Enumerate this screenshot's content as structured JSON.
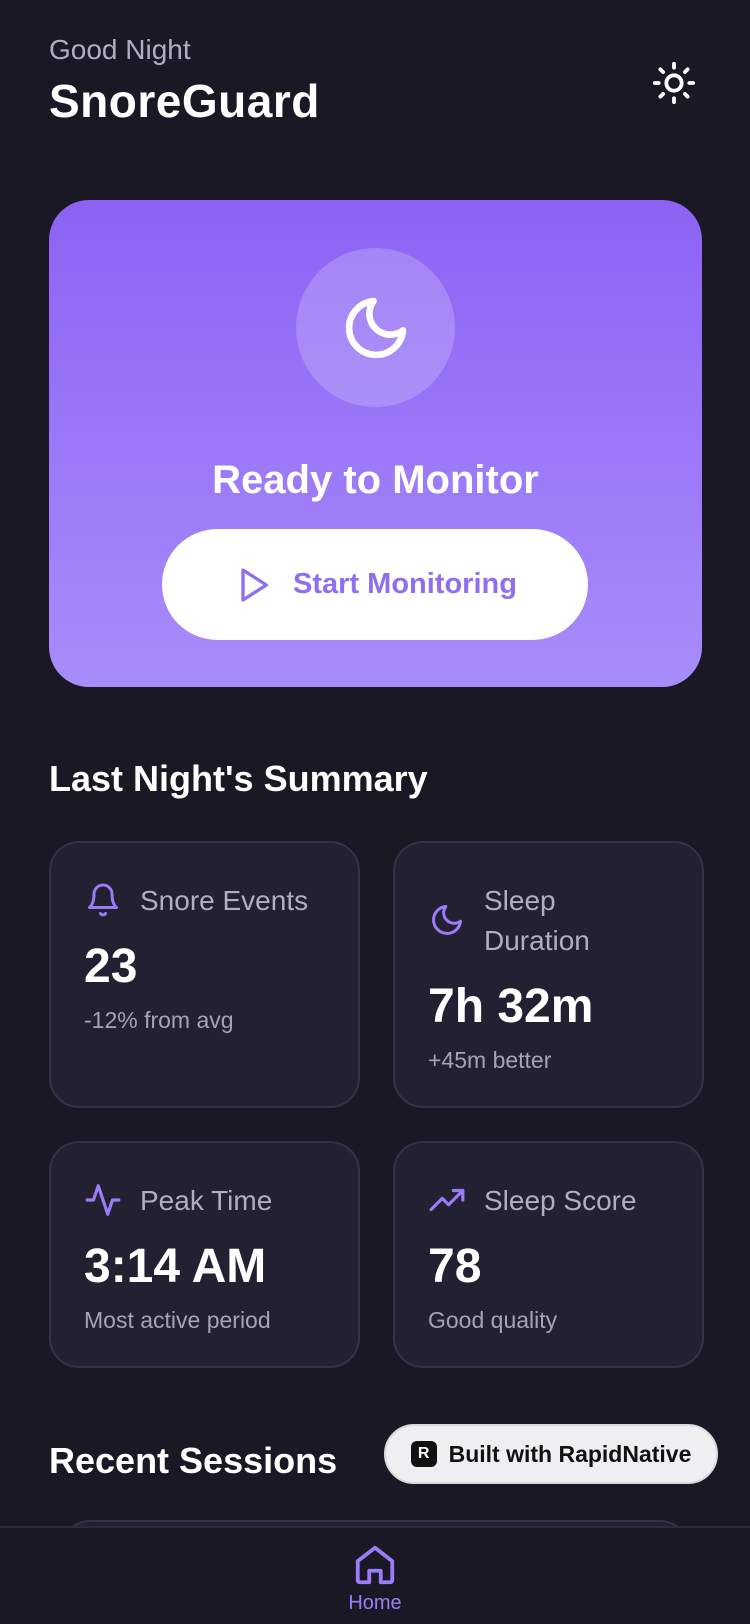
{
  "header": {
    "greeting": "Good Night",
    "title": "SnoreGuard",
    "theme_icon": "sun-icon"
  },
  "hero": {
    "icon": "moon-icon",
    "status": "Ready to Monitor",
    "button_label": "Start Monitoring",
    "button_icon": "play-icon"
  },
  "summary": {
    "title": "Last Night's Summary",
    "cards": [
      {
        "icon": "bell-icon",
        "label": "Snore Events",
        "value": "23",
        "sub": "-12% from avg"
      },
      {
        "icon": "moon-icon",
        "label": "Sleep Duration",
        "value": "7h 32m",
        "sub": "+45m better"
      },
      {
        "icon": "activity-icon",
        "label": "Peak Time",
        "value": "3:14 AM",
        "sub": "Most active period"
      },
      {
        "icon": "trending-up-icon",
        "label": "Sleep Score",
        "value": "78",
        "sub": "Good quality"
      }
    ]
  },
  "recent": {
    "title": "Recent Sessions"
  },
  "badge": {
    "logo": "R",
    "label": "Built with RapidNative"
  },
  "nav": {
    "items": [
      {
        "label": "Home",
        "icon": "home-icon"
      }
    ]
  },
  "colors": {
    "accent": "#8b63f4",
    "background": "#1b1826",
    "card": "#232031"
  }
}
